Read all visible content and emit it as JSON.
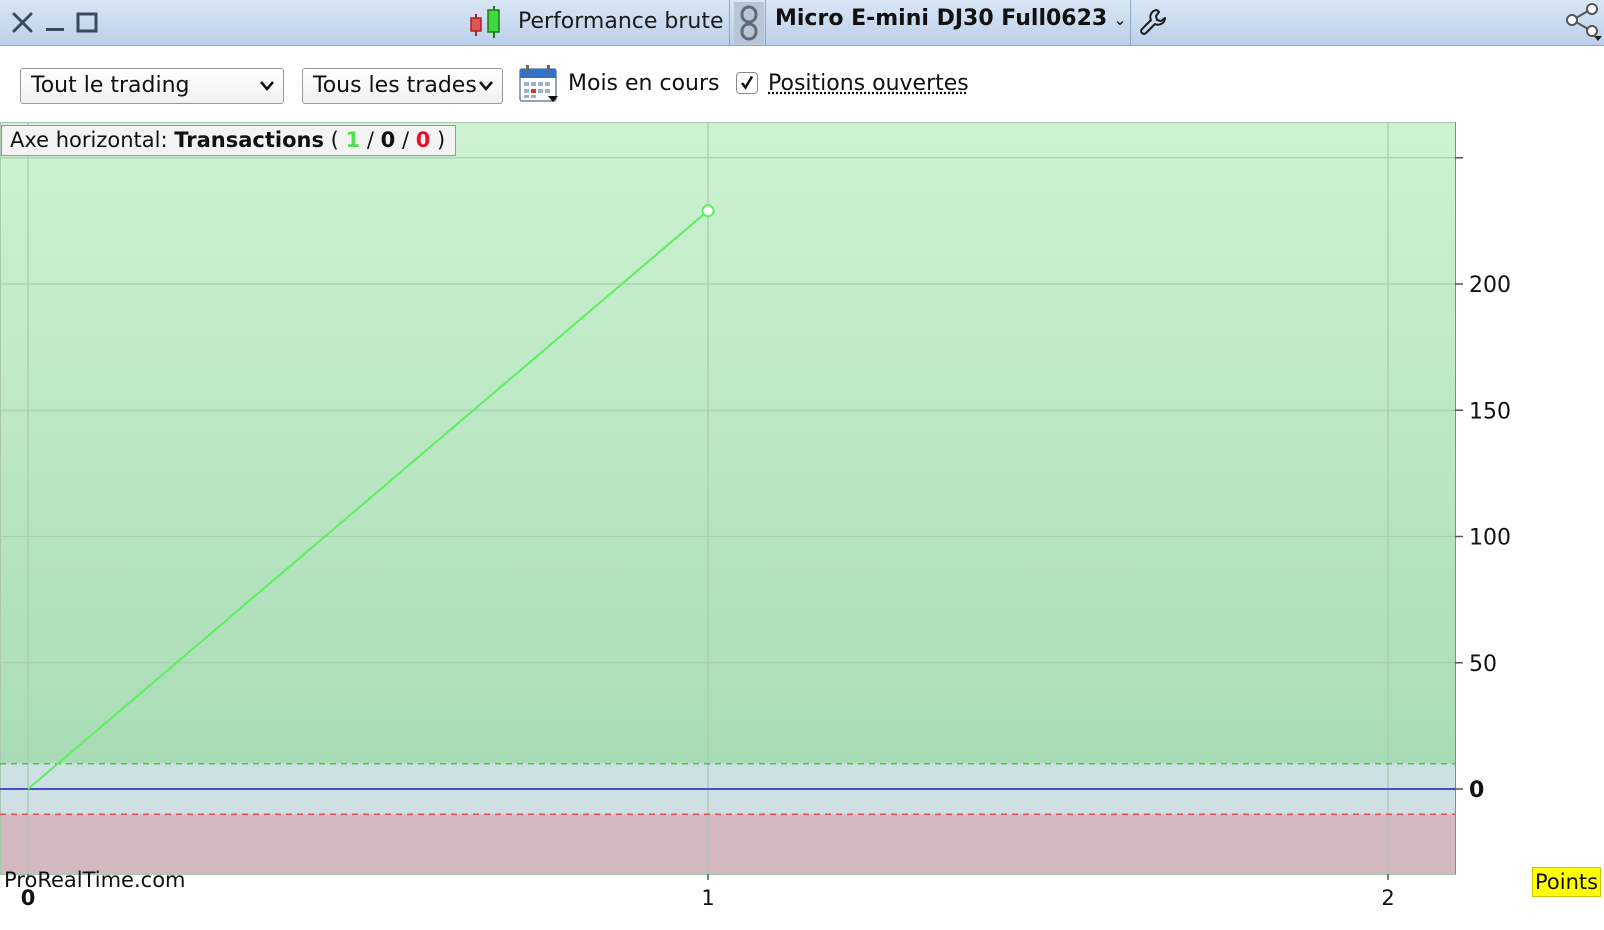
{
  "window": {
    "title": "Performance brute",
    "instrument": "Micro E-mini DJ30 Full0623"
  },
  "toolbar": {
    "scope_select": "Tout le trading",
    "trades_select": "Tous les trades",
    "period_label": "Mois en cours",
    "open_positions_label": "Positions ouvertes",
    "open_positions_checked": true
  },
  "axis_badge": {
    "prefix": "Axe horizontal:",
    "mode": "Transactions",
    "open_paren": "(",
    "wins": "1",
    "slash": "/",
    "neutral": "0",
    "losses": "0",
    "close_paren": ")"
  },
  "watermark": "ProRealTime.com",
  "unit_badge": "Points",
  "colors": {
    "profit_zone": "#b8e6c4",
    "loss_zone": "#d3b8c2",
    "equity_line": "#5cf05c",
    "zero_line": "#1f1fbf",
    "wins_text": "#4ee04e",
    "losses_text": "#e8102a"
  },
  "icons": {
    "close": "close-icon",
    "minimize": "minimize-icon",
    "maximize": "maximize-icon",
    "candles": "candlestick-icon",
    "link": "link-icon",
    "settings": "wrench-icon",
    "share": "share-icon",
    "calendar": "calendar-icon"
  },
  "chart_data": {
    "type": "line",
    "title": "",
    "xlabel": "",
    "ylabel": "",
    "x": [
      0,
      1
    ],
    "series": [
      {
        "values": [
          0,
          229
        ]
      }
    ],
    "xlim": [
      -0.04,
      2.1
    ],
    "ylim": [
      -34,
      250
    ],
    "x_ticks": [
      "0",
      "1",
      "2"
    ],
    "y_ticks": [
      "0",
      "50",
      "100",
      "150",
      "200"
    ],
    "thresholds": {
      "upper_dashed": 10,
      "lower_dashed": -10,
      "zero": 0
    },
    "grid": true,
    "y_axis_side": "right"
  }
}
